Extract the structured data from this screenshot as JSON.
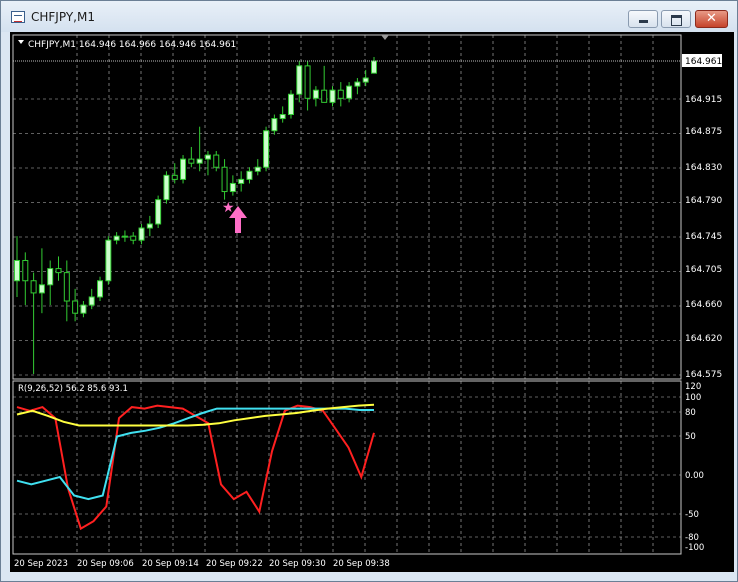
{
  "window": {
    "title": "CHFJPY,M1",
    "minimize_icon": "minimize-icon",
    "maximize_icon": "maximize-icon",
    "close_icon": "close-icon",
    "close_glyph": "✕"
  },
  "chart": {
    "header_text": "CHFJPY,M1  164.946 164.966 164.946 164.961",
    "current_price": "164.961",
    "price_ticks": [
      "164.915",
      "164.875",
      "164.830",
      "164.790",
      "164.745",
      "164.705",
      "164.660",
      "164.620",
      "164.575"
    ],
    "time_ticks": [
      "20 Sep 2023",
      "20 Sep 09:06",
      "20 Sep 09:14",
      "20 Sep 09:22",
      "20 Sep 09:30",
      "20 Sep 09:38"
    ],
    "markers": {
      "star_icon": "star-icon",
      "arrow_icon": "up-arrow-icon"
    },
    "colors": {
      "background": "#000000",
      "grid": "#c0c0c0",
      "bull_candle": "#ccffcc",
      "wick": "#33cc33"
    }
  },
  "indicator": {
    "label": "R(9,26,52) 56.2 85.6 93.1",
    "scale_ticks": [
      "120",
      "100",
      "80",
      "50",
      "0.00",
      "-50",
      "-80",
      "-100"
    ],
    "colors": {
      "fast": "#ff2020",
      "medium": "#40e0f0",
      "slow": "#ffff40"
    }
  },
  "chart_data": {
    "type": "candlestick",
    "symbol": "CHFJPY",
    "timeframe": "M1",
    "ylim": [
      164.575,
      164.961
    ],
    "candles_ohlc": [
      [
        164.69,
        164.745,
        164.67,
        164.715
      ],
      [
        164.715,
        164.725,
        164.66,
        164.69
      ],
      [
        164.69,
        164.7,
        164.575,
        164.675
      ],
      [
        164.675,
        164.73,
        164.65,
        164.685
      ],
      [
        164.685,
        164.715,
        164.66,
        164.705
      ],
      [
        164.705,
        164.72,
        164.69,
        164.7
      ],
      [
        164.7,
        164.715,
        164.64,
        164.665
      ],
      [
        164.665,
        164.68,
        164.64,
        164.65
      ],
      [
        164.65,
        164.665,
        164.645,
        164.66
      ],
      [
        164.66,
        164.68,
        164.655,
        164.67
      ],
      [
        164.67,
        164.695,
        164.665,
        164.69
      ],
      [
        164.69,
        164.745,
        164.685,
        164.74
      ],
      [
        164.74,
        164.75,
        164.735,
        164.745
      ],
      [
        164.745,
        164.752,
        164.738,
        164.745
      ],
      [
        164.745,
        164.75,
        164.735,
        164.74
      ],
      [
        164.74,
        164.76,
        164.735,
        164.755
      ],
      [
        164.755,
        164.77,
        164.745,
        164.76
      ],
      [
        164.76,
        164.795,
        164.755,
        164.79
      ],
      [
        164.79,
        164.825,
        164.785,
        164.82
      ],
      [
        164.82,
        164.835,
        164.81,
        164.815
      ],
      [
        164.815,
        164.845,
        164.81,
        164.84
      ],
      [
        164.84,
        164.855,
        164.83,
        164.835
      ],
      [
        164.835,
        164.88,
        164.825,
        164.84
      ],
      [
        164.84,
        164.85,
        164.82,
        164.845
      ],
      [
        164.845,
        164.85,
        164.825,
        164.83
      ],
      [
        164.83,
        164.84,
        164.79,
        164.8
      ],
      [
        164.8,
        164.82,
        164.795,
        164.81
      ],
      [
        164.81,
        164.825,
        164.8,
        164.815
      ],
      [
        164.815,
        164.83,
        164.81,
        164.825
      ],
      [
        164.825,
        164.84,
        164.82,
        164.83
      ],
      [
        164.83,
        164.88,
        164.825,
        164.875
      ],
      [
        164.875,
        164.895,
        164.87,
        164.89
      ],
      [
        164.89,
        164.905,
        164.885,
        164.895
      ],
      [
        164.895,
        164.925,
        164.89,
        164.92
      ],
      [
        164.92,
        164.961,
        164.91,
        164.955
      ],
      [
        164.955,
        164.961,
        164.9,
        164.915
      ],
      [
        164.915,
        164.93,
        164.905,
        164.925
      ],
      [
        164.925,
        164.955,
        164.91,
        164.91
      ],
      [
        164.91,
        164.93,
        164.905,
        164.925
      ],
      [
        164.925,
        164.935,
        164.905,
        164.915
      ],
      [
        164.915,
        164.935,
        164.91,
        164.93
      ],
      [
        164.93,
        164.94,
        164.92,
        164.935
      ],
      [
        164.935,
        164.95,
        164.93,
        164.94
      ],
      [
        164.946,
        164.966,
        164.946,
        164.961
      ]
    ],
    "indicator": {
      "name": "R(9,26,52)",
      "ylim": [
        -100,
        120
      ],
      "series": [
        {
          "name": "fast",
          "values": [
            90,
            85,
            90,
            75,
            -20,
            -75,
            -65,
            -45,
            75,
            90,
            88,
            92,
            90,
            88,
            78,
            68,
            -15,
            -35,
            -25,
            -52,
            30,
            85,
            92,
            90,
            85,
            60,
            35,
            -5,
            55
          ]
        },
        {
          "name": "medium",
          "values": [
            -10,
            -15,
            -10,
            -5,
            -30,
            -35,
            -30,
            50,
            55,
            58,
            62,
            68,
            75,
            82,
            88,
            88,
            88,
            88,
            88,
            88,
            88,
            88,
            88,
            88,
            86,
            86
          ]
        },
        {
          "name": "slow",
          "values": [
            80,
            85,
            78,
            70,
            65,
            65,
            65,
            65,
            65,
            65,
            65,
            65,
            66,
            68,
            72,
            75,
            78,
            80,
            82,
            85,
            88,
            90,
            92,
            93.1
          ]
        }
      ]
    }
  }
}
